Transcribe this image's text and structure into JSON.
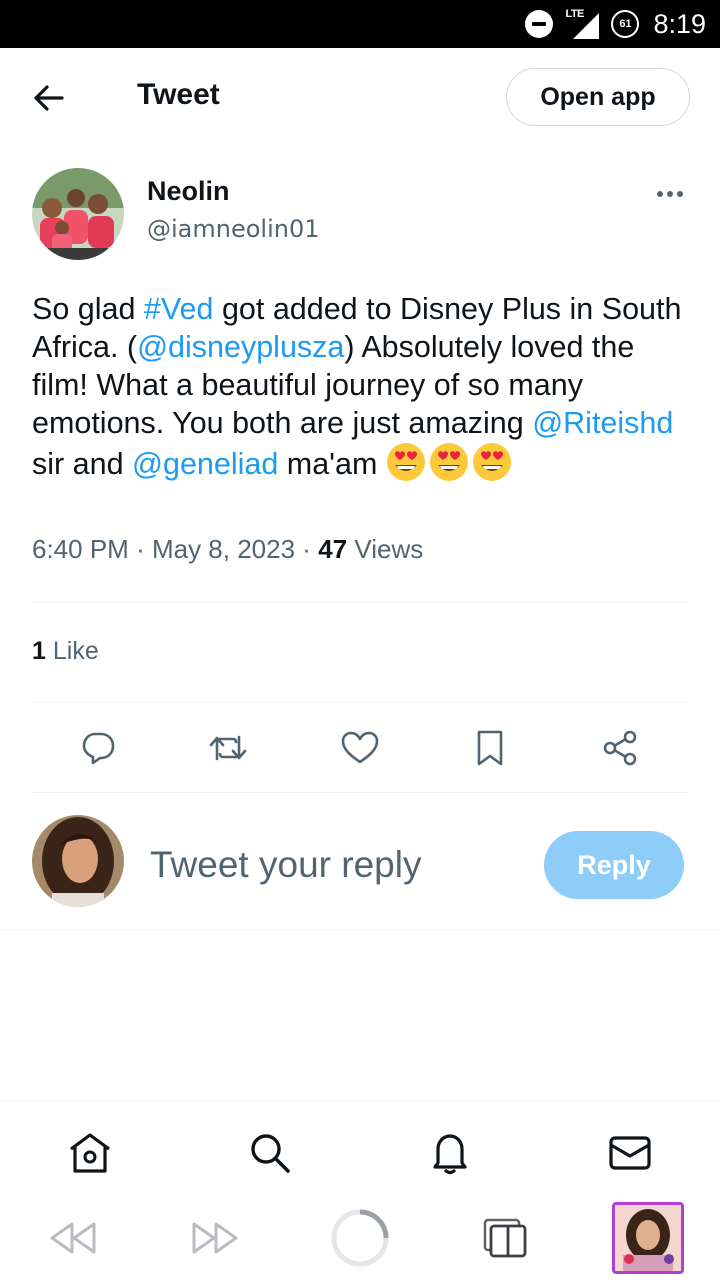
{
  "status_bar": {
    "network": "LTE",
    "battery": "61",
    "time": "8:19"
  },
  "header": {
    "title": "Tweet",
    "open_app_label": "Open app"
  },
  "tweet": {
    "author_name": "Neolin",
    "author_handle": "@iamneolin01",
    "text_parts": {
      "p1": "So glad ",
      "hashtag": "#Ved",
      "p2": " got added to Disney Plus in South Africa. (",
      "mention1": "@disneyplusza",
      "p3": ") Absolutely loved the film! What a beautiful journey of so many emotions. You both are just amazing ",
      "mention2": "@Riteishd",
      "p4": " sir and ",
      "mention3": "@geneliad",
      "p5": " ma'am "
    },
    "emoji": "heart-eyes-emoji",
    "time": "6:40 PM",
    "date": "May 8, 2023",
    "sep": "·",
    "views_count": "47",
    "views_label": "Views",
    "likes_count": "1",
    "likes_label": "Like"
  },
  "actions": [
    "reply-icon",
    "retweet-icon",
    "like-icon",
    "bookmark-icon",
    "share-icon"
  ],
  "reply": {
    "placeholder": "Tweet your reply",
    "button_label": "Reply"
  },
  "bottom_nav": [
    "home-icon",
    "search-icon",
    "notifications-icon",
    "messages-icon"
  ],
  "browser_bar": [
    "back-icon",
    "forward-icon",
    "reload-icon",
    "tabs-icon",
    "profile-avatar"
  ],
  "colors": {
    "link": "#1d9bf0",
    "reply_button": "#8ecdf8",
    "text": "#0f1419",
    "muted": "#536471"
  }
}
